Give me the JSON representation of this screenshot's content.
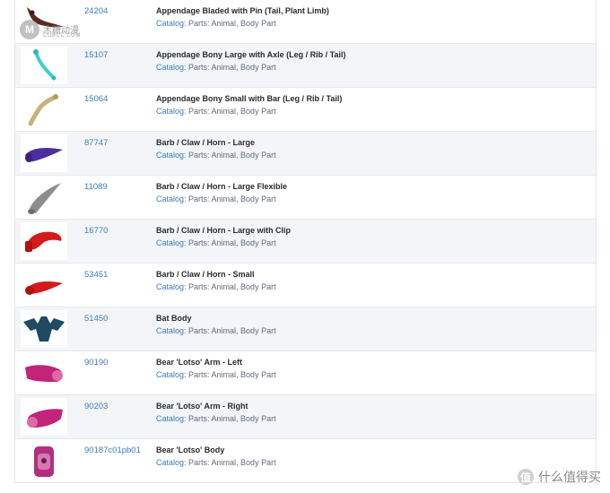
{
  "parts": [
    {
      "number": "24204",
      "title": "Appendage Bladed with Pin (Tail, Plant Limb)",
      "catalog_label": "Catalog",
      "catalog_path": ": Parts: Animal, Body Part",
      "icon": "bladed-appendage-icon",
      "color": "#5a2a22"
    },
    {
      "number": "15107",
      "title": "Appendage Bony Large with Axle (Leg / Rib / Tail)",
      "catalog_label": "Catalog",
      "catalog_path": ": Parts: Animal, Body Part",
      "icon": "bony-large-appendage-icon",
      "color": "#3fcfd0"
    },
    {
      "number": "15064",
      "title": "Appendage Bony Small with Bar (Leg / Rib / Tail)",
      "catalog_label": "Catalog",
      "catalog_path": ": Parts: Animal, Body Part",
      "icon": "bony-small-appendage-icon",
      "color": "#c9b27a"
    },
    {
      "number": "87747",
      "title": "Barb / Claw / Horn - Large",
      "catalog_label": "Catalog",
      "catalog_path": ": Parts: Animal, Body Part",
      "icon": "horn-large-icon",
      "color": "#4b2ea0"
    },
    {
      "number": "11089",
      "title": "Barb / Claw / Horn - Large Flexible",
      "catalog_label": "Catalog",
      "catalog_path": ": Parts: Animal, Body Part",
      "icon": "horn-flexible-icon",
      "color": "#8d8d8d"
    },
    {
      "number": "16770",
      "title": "Barb / Claw / Horn - Large with Clip",
      "catalog_label": "Catalog",
      "catalog_path": ": Parts: Animal, Body Part",
      "icon": "horn-clip-icon",
      "color": "#d41a1a"
    },
    {
      "number": "53451",
      "title": "Barb / Claw / Horn - Small",
      "catalog_label": "Catalog",
      "catalog_path": ": Parts: Animal, Body Part",
      "icon": "horn-small-icon",
      "color": "#d41a1a"
    },
    {
      "number": "51450",
      "title": "Bat Body",
      "catalog_label": "Catalog",
      "catalog_path": ": Parts: Animal, Body Part",
      "icon": "bat-body-icon",
      "color": "#1e4a63"
    },
    {
      "number": "90190",
      "title": "Bear 'Lotso' Arm - Left",
      "catalog_label": "Catalog",
      "catalog_path": ": Parts: Animal, Body Part",
      "icon": "bear-arm-left-icon",
      "color": "#c2247a"
    },
    {
      "number": "90203",
      "title": "Bear 'Lotso' Arm - Right",
      "catalog_label": "Catalog",
      "catalog_path": ": Parts: Animal, Body Part",
      "icon": "bear-arm-right-icon",
      "color": "#c2247a"
    },
    {
      "number": "90187c01pb01",
      "title": "Bear 'Lotso' Body",
      "catalog_label": "Catalog",
      "catalog_path": ": Parts: Animal, Body Part",
      "icon": "bear-body-icon",
      "color": "#b0307f"
    }
  ],
  "watermark_top": {
    "letter": "M",
    "text": "木糖动漫",
    "sub": "COBCC.COM"
  },
  "watermark_bottom": {
    "letter": "值",
    "text": "什么值得买"
  }
}
